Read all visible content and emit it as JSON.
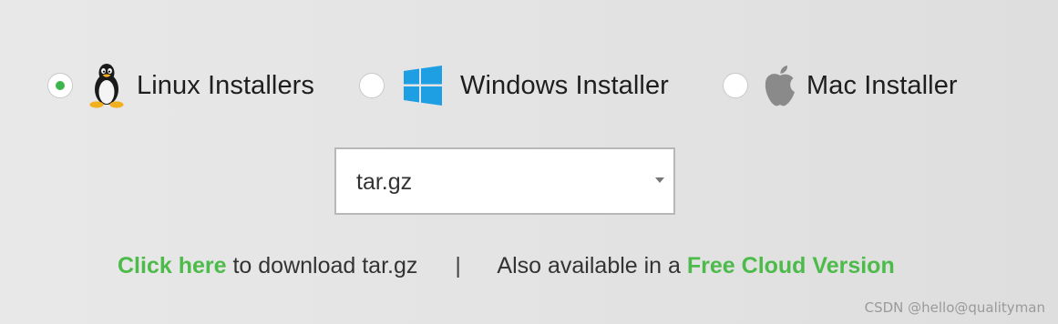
{
  "installers": {
    "linux": {
      "label": "Linux Installers",
      "icon": "tux-penguin-icon",
      "selected": true
    },
    "windows": {
      "label": "Windows Installer",
      "icon": "windows-logo-icon",
      "selected": false
    },
    "mac": {
      "label": "Mac Installer",
      "icon": "apple-logo-icon",
      "selected": false
    }
  },
  "format_select": {
    "value": "tar.gz"
  },
  "download": {
    "link_label": "Click here",
    "text": "to download tar.gz",
    "separator": "|",
    "also_text": "Also available in a",
    "cloud_link_label": "Free Cloud Version"
  },
  "watermark": "CSDN @hello@qualityman",
  "colors": {
    "accent_green": "#4cbb4a",
    "radio_dot": "#3cb54a",
    "windows_blue": "#1e9fe3",
    "apple_gray": "#8a8a8a"
  }
}
